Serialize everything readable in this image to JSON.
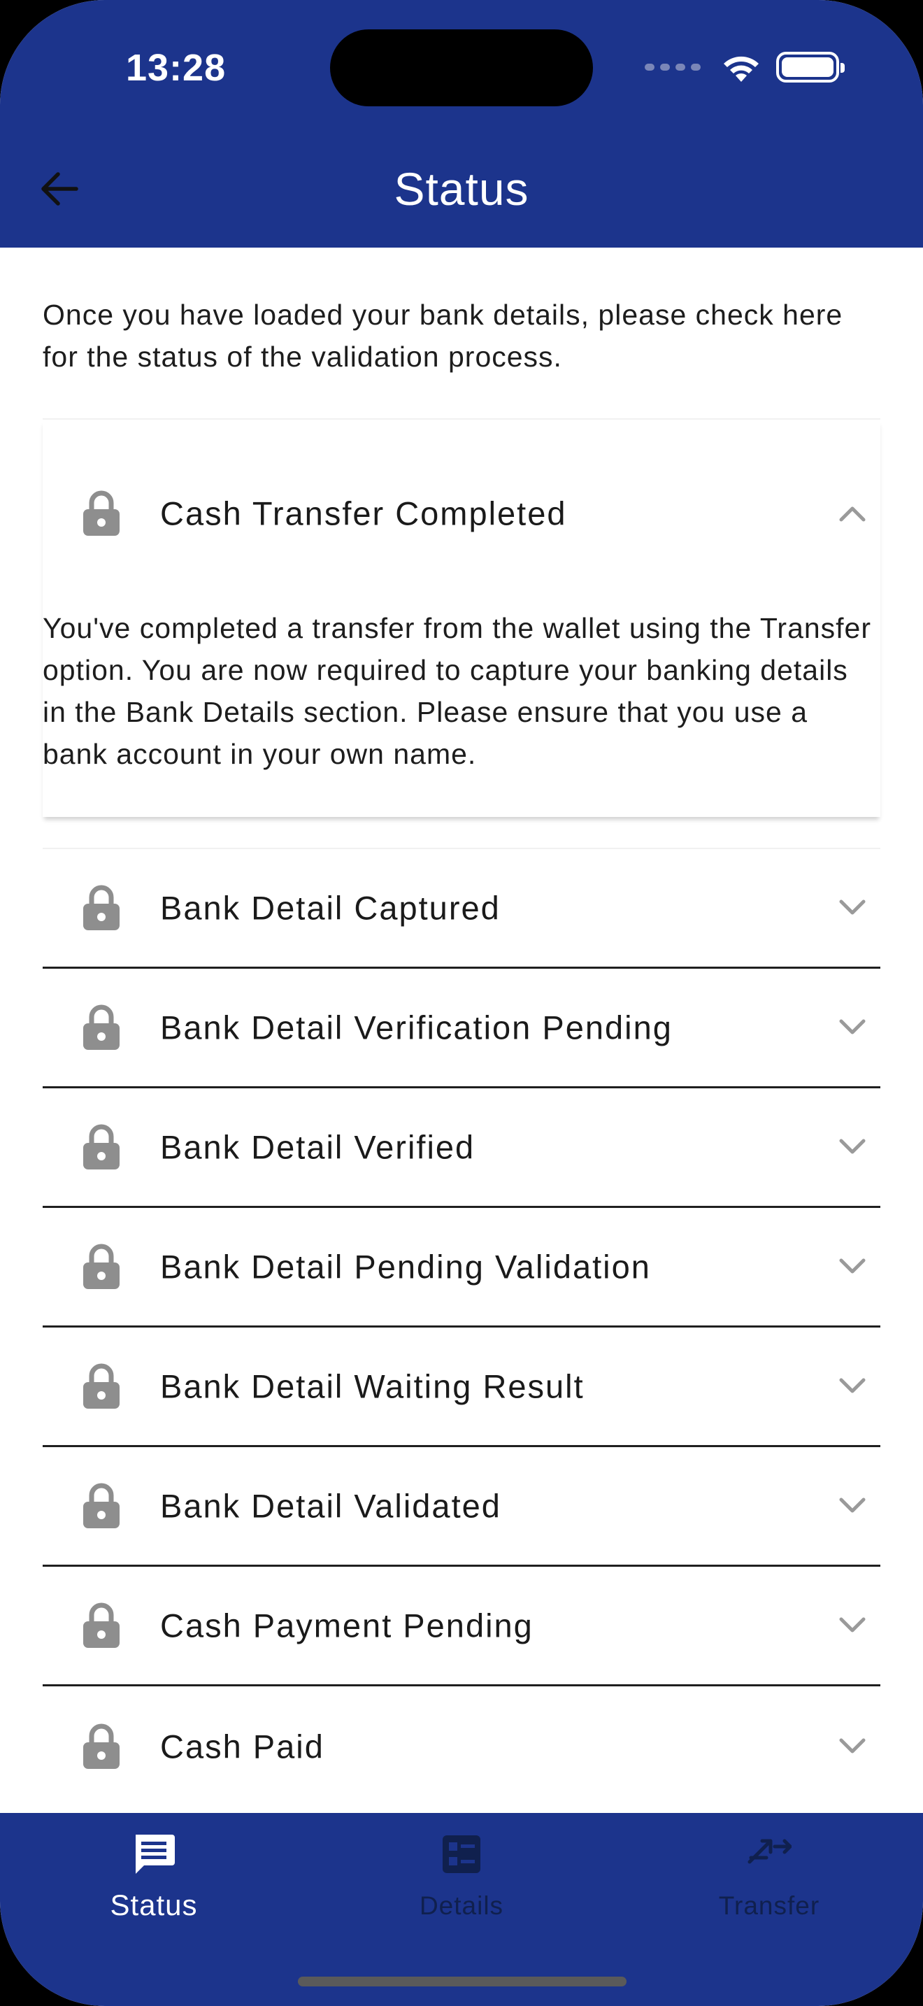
{
  "status_bar": {
    "time": "13:28"
  },
  "header": {
    "title": "Status"
  },
  "intro_text": "Once you have loaded your bank details, please check here for the status of the validation process.",
  "expanded_item": {
    "title": "Cash Transfer Completed",
    "body": "You've completed a transfer from the wallet using the Transfer option. You are now required to capture your banking details in the Bank Details section. Please ensure that you use a bank account in your own name."
  },
  "items": [
    {
      "title": "Bank Detail Captured"
    },
    {
      "title": "Bank Detail Verification Pending"
    },
    {
      "title": "Bank Detail Verified"
    },
    {
      "title": "Bank Detail Pending Validation"
    },
    {
      "title": "Bank Detail Waiting Result"
    },
    {
      "title": "Bank Detail Validated"
    },
    {
      "title": "Cash Payment Pending"
    },
    {
      "title": "Cash Paid"
    }
  ],
  "bottom_nav": {
    "status": "Status",
    "details": "Details",
    "transfer": "Transfer"
  },
  "colors": {
    "brand": "#1c348c",
    "lock": "#8e8e8e",
    "chevron": "#9a9a9a",
    "nav_inactive": "#10204e"
  },
  "icons": [
    "back-arrow-icon",
    "lock-icon",
    "chevron-up-icon",
    "chevron-down-icon",
    "message-icon",
    "list-card-icon",
    "transfer-arrows-icon",
    "wifi-icon",
    "battery-icon"
  ]
}
